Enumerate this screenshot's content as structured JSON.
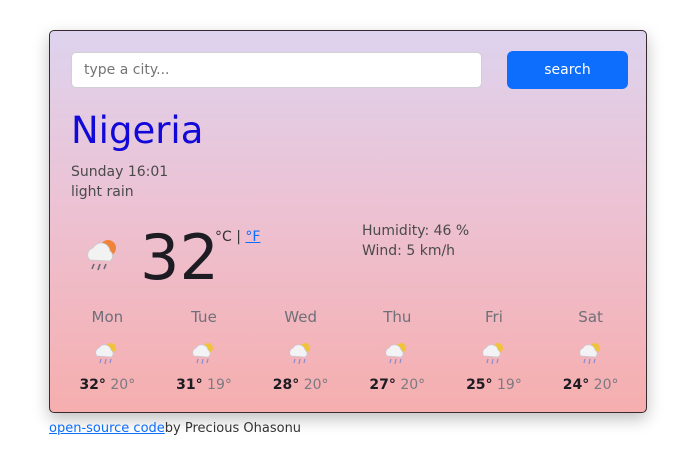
{
  "search": {
    "placeholder": "type a city...",
    "button_label": "search"
  },
  "city": "Nigeria",
  "datetime": "Sunday 16:01",
  "description": "light rain",
  "current": {
    "temperature": "32",
    "unit_celsius": "°C",
    "separator": " | ",
    "unit_fahrenheit": "°F",
    "icon": "rain-cloud-sun-icon",
    "humidity": "Humidity: 46 %",
    "wind": "Wind: 5 km/h"
  },
  "forecast": [
    {
      "day": "Mon",
      "max": "32°",
      "min": "20°",
      "icon": "rain-cloud-sun-icon"
    },
    {
      "day": "Tue",
      "max": "31°",
      "min": "19°",
      "icon": "rain-cloud-sun-icon"
    },
    {
      "day": "Wed",
      "max": "28°",
      "min": "20°",
      "icon": "rain-cloud-sun-icon"
    },
    {
      "day": "Thu",
      "max": "27°",
      "min": "20°",
      "icon": "rain-cloud-sun-icon"
    },
    {
      "day": "Fri",
      "max": "25°",
      "min": "19°",
      "icon": "rain-cloud-sun-icon"
    },
    {
      "day": "Sat",
      "max": "24°",
      "min": "20°",
      "icon": "rain-cloud-sun-icon"
    }
  ],
  "footer": {
    "link_text": "open-source code",
    "credit": "by Precious Ohasonu"
  },
  "colors": {
    "accent": "#0d6efd",
    "city": "#1208d8"
  }
}
